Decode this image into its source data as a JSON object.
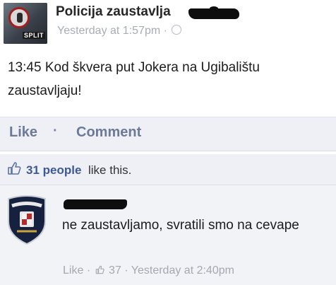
{
  "post": {
    "author": "Policija zaustavlja",
    "avatar_tag": "SPLIT",
    "timestamp": "Yesterday at 1:57pm",
    "separator": "·",
    "text": "13:45 Kod škvera put Jokera na Ugibalištu zaustavljaju!"
  },
  "actions": {
    "like_label": "Like",
    "separator": "·",
    "comment_label": "Comment"
  },
  "likes": {
    "count_text": "31 people",
    "suffix": "like this."
  },
  "comment": {
    "text": "ne zaustavljamo, svratili smo na cevape",
    "like_label": "Like",
    "separator": "·",
    "like_count": "37",
    "timestamp": "Yesterday at 2:40pm"
  },
  "colors": {
    "link_blue": "#3d5a96",
    "action_gray_blue": "#6c7a97",
    "action_bar_bg": "#eef0f6"
  }
}
